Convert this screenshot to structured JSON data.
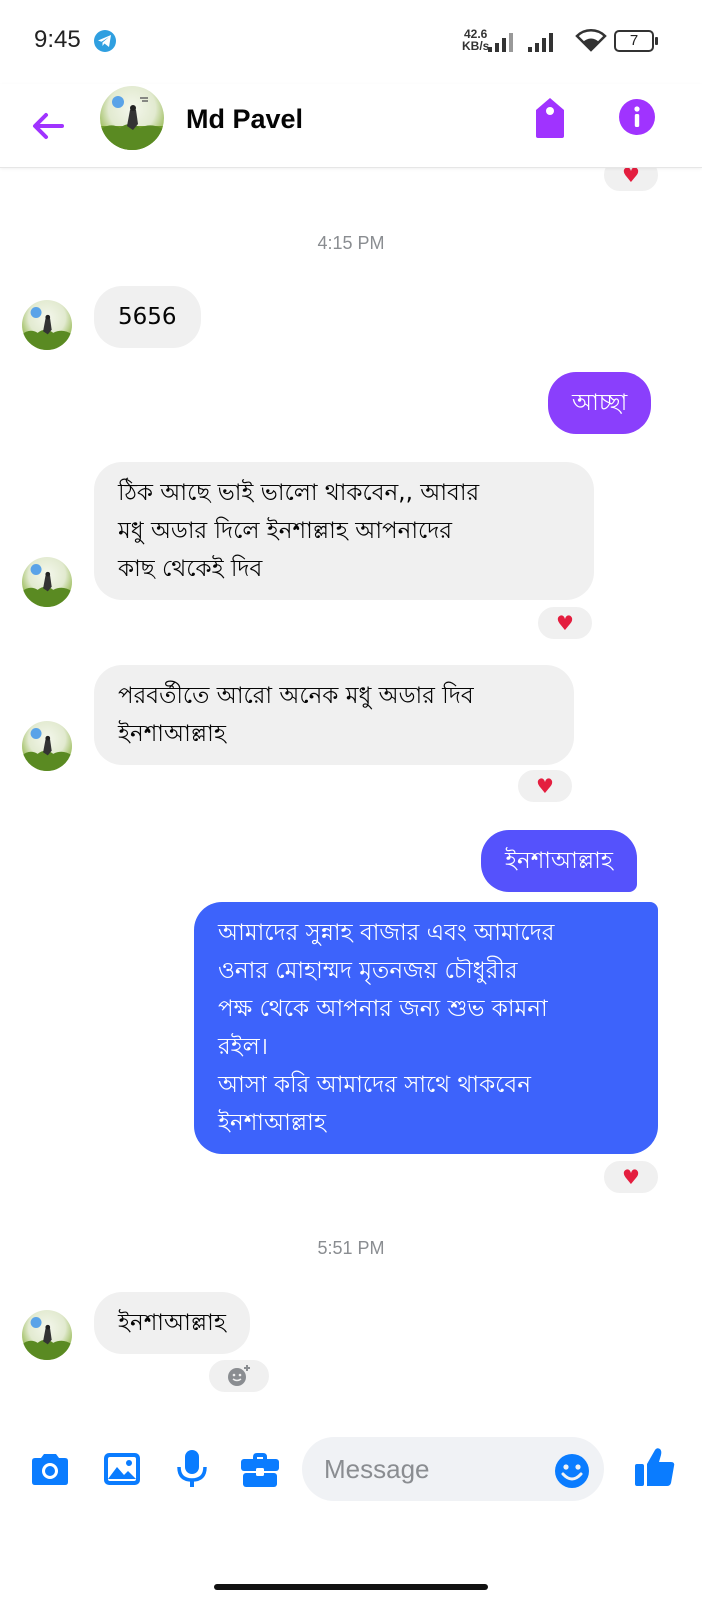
{
  "status_bar": {
    "time": "9:45",
    "net_speed_value": "42.6",
    "net_speed_unit": "KB/s",
    "battery": "7"
  },
  "header": {
    "contact_name": "Md Pavel"
  },
  "messages": {
    "top_reaction": "♥",
    "time_1": "4:15 PM",
    "m1": "5656",
    "m2": "আচ্ছা",
    "m3_l1": "ঠিক আছে ভাই ভালো থাকবেন,, আবার",
    "m3_l2": "মধু অডার দিলে ইনশাল্লাহ আপনাদের",
    "m3_l3": "কাছ থেকেই দিব",
    "m3_reaction": "♥",
    "m4_l1": "পরবর্তীতে আরো অনেক মধু অডার দিব",
    "m4_l2": "ইনশাআল্লাহ",
    "m4_reaction": "♥",
    "m5": "ইনশাআল্লাহ",
    "m6_l1": "আমাদের সুন্নাহ বাজার এবং আমাদের",
    "m6_l2": "ওনার মোহাম্মদ মৃতনজয় চৌধুরীর",
    "m6_l3": "পক্ষ থেকে আপনার জন্য শুভ কামনা",
    "m6_l4": "রইল।",
    "m6_l5": "আসা করি আমাদের সাথে থাকবেন",
    "m6_l6": "ইনশাআল্লাহ",
    "m6_reaction": "♥",
    "time_2": "5:51 PM",
    "m7": "ইনশাআল্লাহ"
  },
  "composer": {
    "placeholder": "Message"
  },
  "colors": {
    "accent": "#a033ff",
    "bubble_in": "#f0f0f0",
    "bubble_out_purple": "#8a3ffc",
    "bubble_out_blue": "#3d63fb",
    "icon_blue": "#0a7cff",
    "heart": "#e41e3f"
  },
  "icons": [
    "telegram-icon",
    "back-arrow-icon",
    "tag-icon",
    "info-icon",
    "camera-icon",
    "gallery-icon",
    "microphone-icon",
    "briefcase-icon",
    "emoji-icon",
    "thumbs-up-icon"
  ]
}
